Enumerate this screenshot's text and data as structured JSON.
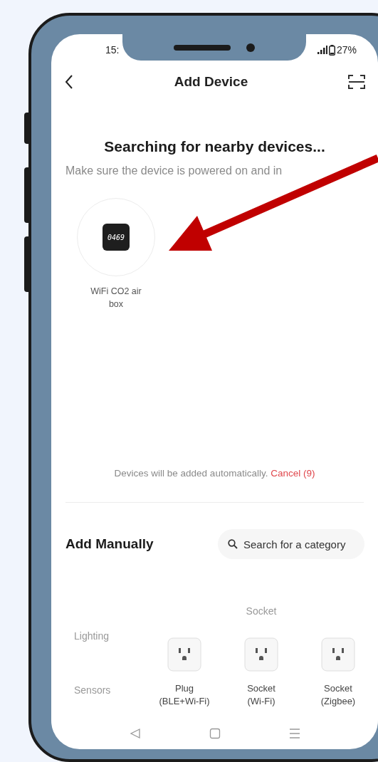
{
  "status_bar": {
    "time": "15:",
    "battery": "27%"
  },
  "header": {
    "title": "Add Device"
  },
  "searching": {
    "title": "Searching for nearby devices...",
    "subtitle": "Make sure the device is powered on and in"
  },
  "found_devices": [
    {
      "name": "WiFi CO2 air\nbox",
      "reading": "0469"
    }
  ],
  "auto_add": {
    "text": "Devices will be added automatically.",
    "cancel": "Cancel (9)"
  },
  "manual": {
    "title": "Add Manually",
    "search": {
      "placeholder": "Search for a category"
    },
    "categories": [
      {
        "label": "Lighting"
      },
      {
        "label": "Sensors"
      }
    ],
    "group_title": "Socket",
    "items": [
      {
        "label": "Plug\n(BLE+Wi-Fi)"
      },
      {
        "label": "Socket\n(Wi-Fi)"
      },
      {
        "label": "Socket\n(Zigbee)"
      }
    ]
  }
}
